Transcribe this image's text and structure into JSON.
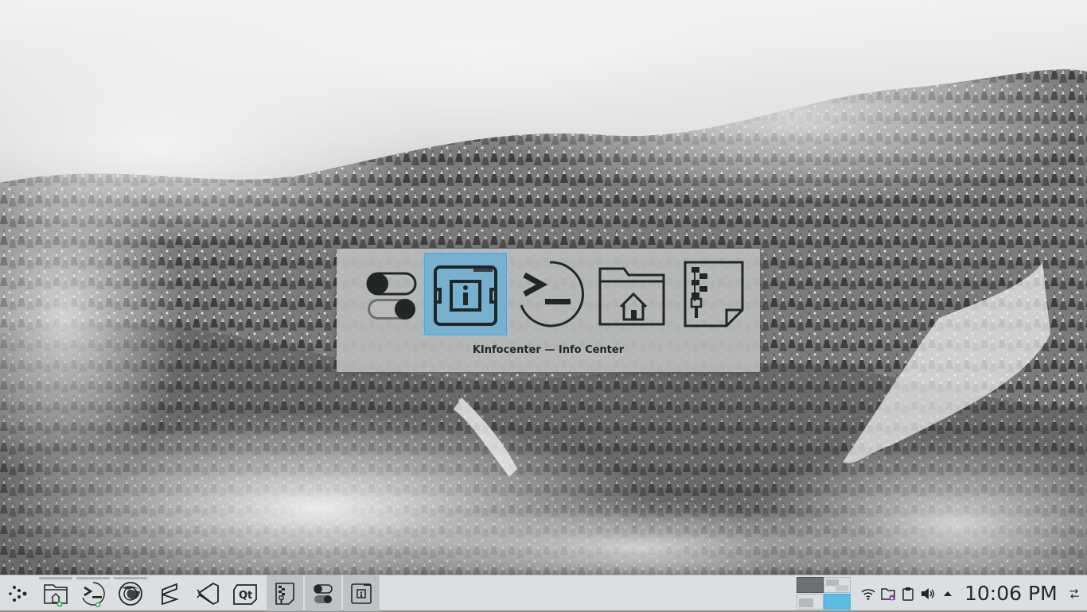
{
  "switcher": {
    "caption": "KInfocenter — Info Center",
    "items": [
      {
        "app": "system-settings",
        "icon": "toggle-switches-icon"
      },
      {
        "app": "kinfocenter",
        "icon": "info-chip-icon",
        "selected": true
      },
      {
        "app": "konsole",
        "icon": "terminal-prompt-icon"
      },
      {
        "app": "dolphin",
        "icon": "home-folder-icon"
      },
      {
        "app": "ark",
        "icon": "archive-file-icon"
      }
    ]
  },
  "panel": {
    "launchers": [
      {
        "name": "application-launcher",
        "icon": "kde-menu-icon"
      },
      {
        "name": "dolphin",
        "icon": "home-folder-icon"
      },
      {
        "name": "konsole",
        "icon": "terminal-prompt-icon"
      },
      {
        "name": "firefox",
        "icon": "globe-icon"
      },
      {
        "name": "sublime-text",
        "icon": "s-logo-icon"
      },
      {
        "name": "visual-studio-code",
        "icon": "code-bracket-icon"
      },
      {
        "name": "qt-creator",
        "icon": "qt-logo-icon"
      },
      {
        "name": "ark",
        "icon": "archive-file-icon"
      },
      {
        "name": "system-settings",
        "icon": "toggle-switches-icon"
      },
      {
        "name": "kinfocenter",
        "icon": "info-chip-icon"
      }
    ],
    "clock": "10:06 PM",
    "tray_icons": [
      "wifi-icon",
      "vault-folder-icon",
      "clipboard-icon",
      "volume-icon",
      "expand-arrow-icon"
    ],
    "colors": {
      "accent": "#3daee9",
      "panel": "#dcdfe1",
      "selection": "#76b2cf"
    }
  }
}
